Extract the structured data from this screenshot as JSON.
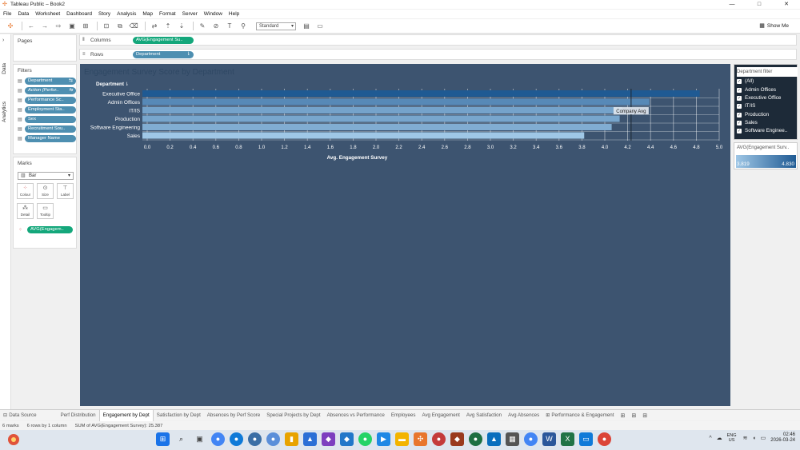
{
  "window": {
    "title": "Tableau Public – Book2",
    "controls": [
      "—",
      "□",
      "✕"
    ]
  },
  "menu": [
    "File",
    "Data",
    "Worksheet",
    "Dashboard",
    "Story",
    "Analysis",
    "Map",
    "Format",
    "Server",
    "Window",
    "Help"
  ],
  "toolbar": {
    "fit_value": "Standard",
    "show_me_label": "Show Me"
  },
  "left_rail": {
    "data_tab": "Data",
    "analytics_tab": "Analytics"
  },
  "pages": {
    "title": "Pages"
  },
  "filters": {
    "title": "Filters",
    "items": [
      "Department",
      "Action (Perfor..",
      "Performance Sc..",
      "Employment Sta..",
      "Sex",
      "Recruitment Sou..",
      "Manager Name"
    ]
  },
  "marks": {
    "title": "Marks",
    "type": "Bar",
    "buttons": [
      "Colour",
      "Size",
      "Label",
      "Detail",
      "Tooltip"
    ],
    "pill": "AVG(Engagem.."
  },
  "shelves": {
    "columns_label": "Columns",
    "columns_pill": "AVG(Engagement Su..",
    "rows_label": "Rows",
    "rows_pill": "Department"
  },
  "chart_data": {
    "type": "bar",
    "title": "Engagement Survey Score by Department",
    "row_header": "Department",
    "categories": [
      "Executive Office",
      "Admin Offices",
      "IT/IS",
      "Production",
      "Software Engineering",
      "Sales"
    ],
    "values": [
      4.83,
      4.39,
      4.15,
      4.13,
      4.06,
      3.82
    ],
    "xlabel": "Avg. Engagement Survey",
    "xlim": [
      0.0,
      5.0
    ],
    "xticks": [
      "0.0",
      "0.2",
      "0.4",
      "0.6",
      "0.8",
      "1.0",
      "1.2",
      "1.4",
      "1.6",
      "1.8",
      "2.0",
      "2.2",
      "2.4",
      "2.6",
      "2.8",
      "3.0",
      "3.2",
      "3.4",
      "3.6",
      "3.8",
      "4.0",
      "4.2",
      "4.4",
      "4.6",
      "4.8",
      "5.0"
    ],
    "reference_line": {
      "label": "Company Avg",
      "value": 4.23
    },
    "grid": true,
    "colors": {
      "bar_light": "#9fc7e6",
      "bar_dark": "#1f5a93",
      "background": "#3d5470"
    }
  },
  "department_filter": {
    "title": "Department filter",
    "options": [
      "(All)",
      "Admin Offices",
      "Executive Office",
      "IT/IS",
      "Production",
      "Sales",
      "Software Enginee.."
    ]
  },
  "color_legend": {
    "title": "AVG(Engagement Surv..",
    "min": "3.819",
    "max": "4.830"
  },
  "sheet_tabs": {
    "items": [
      "Data Source",
      "Perf Distribution",
      "Engagement by Dept",
      "Satisfaction by Dept",
      "Absences by Perf Score",
      "Special Projects by Dept",
      "Absences vs Performance",
      "Employees",
      "Avg Engagement",
      "Avg Satisfaction",
      "Avg Absences",
      "Performance & Engagement"
    ],
    "active": "Engagement by Dept"
  },
  "status": {
    "marks": "6 marks",
    "rows_cols": "6 rows by 1 column",
    "sum": "SUM of AVG(Engagement Survey): 25.387"
  },
  "taskbar": {
    "lang_top": "ENG",
    "lang_bottom": "US",
    "time": "02:46",
    "date": "2026-03-24"
  }
}
